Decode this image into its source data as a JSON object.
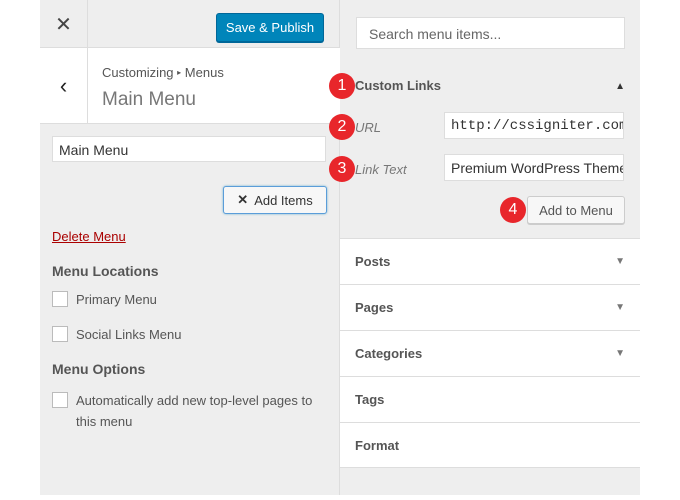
{
  "header": {
    "close_icon": "close-icon",
    "save_label": "Save & Publish"
  },
  "title_section": {
    "breadcrumb_root": "Customizing",
    "breadcrumb_sep": "▸",
    "breadcrumb_current": "Menus",
    "title": "Main Menu"
  },
  "menu": {
    "name_value": "Main Menu",
    "add_items_label": "Add Items",
    "delete_label": "Delete Menu",
    "locations_heading": "Menu Locations",
    "locations": [
      {
        "label": "Primary Menu",
        "checked": false
      },
      {
        "label": "Social Links Menu",
        "checked": false
      }
    ],
    "options_heading": "Menu Options",
    "auto_add_label": "Automatically add new top-level pages to this menu",
    "auto_add_checked": false
  },
  "right": {
    "search_placeholder": "Search menu items...",
    "custom_links": {
      "title": "Custom Links",
      "url_label": "URL",
      "url_value": "http://cssigniter.com/",
      "link_text_label": "Link Text",
      "link_text_value": "Premium WordPress Themes",
      "add_label": "Add to Menu"
    },
    "sections": [
      "Posts",
      "Pages",
      "Categories",
      "Tags",
      "Format"
    ]
  },
  "badges": [
    "1",
    "2",
    "3",
    "4"
  ],
  "colors": {
    "primary": "#0085ba",
    "badge": "#e8262b",
    "delete": "#a00"
  }
}
